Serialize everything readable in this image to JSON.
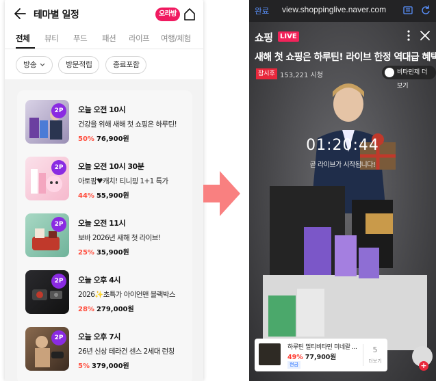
{
  "left": {
    "header": {
      "title": "테마별 일정",
      "live_badge": "오라방"
    },
    "tabs": [
      "전체",
      "뷰티",
      "푸드",
      "패션",
      "라이프",
      "여행/체험"
    ],
    "filters": [
      "방송",
      "방문적립",
      "종료포함"
    ],
    "items": [
      {
        "time": "오늘 오전 10시",
        "title": "건강을 위해 새해 첫 쇼핑은 하루틴!",
        "discount": "50%",
        "price": "76,900원",
        "badge": "2P"
      },
      {
        "time": "오늘 오전 10시 30분",
        "title": "아토팜♥캐치! 티니핑 1+1 특가",
        "discount": "44%",
        "price": "55,900원",
        "badge": "2P"
      },
      {
        "time": "오늘 오전 11시",
        "title": "보바 2026년 새해 첫 라이브!",
        "discount": "25%",
        "price": "35,900원",
        "badge": "2P"
      },
      {
        "time": "오늘 오후 4시",
        "title": "2026✨초특가 아이언맨 블랙박스",
        "discount": "28%",
        "price": "279,000원",
        "badge": "2P"
      },
      {
        "time": "오늘 오후 7시",
        "title": "26년 신상 테라건 센스 2세대 런칭",
        "discount": "5%",
        "price": "379,000원",
        "badge": "2P"
      }
    ]
  },
  "right": {
    "urlbar": {
      "done": "완료",
      "url": "view.shoppinglive.naver.com"
    },
    "brand": "쇼핑",
    "live_tag": "LIVE",
    "title": "새해 첫 쇼핑은 하루틴! 라이브 한정 역대급 혜택",
    "view_tag": "잠시후",
    "view_count": "153,221 시청",
    "more_pill": "비타민제 더보기",
    "countdown": "01:20:44",
    "starting": "곧 라이브가 시작됩니다!",
    "product": {
      "name": "하루틴 멀티비타민 미네랄 ...",
      "discount": "49%",
      "price": "77,900원",
      "badge": "현금",
      "count": "5",
      "more": "더보기"
    }
  },
  "colors": {
    "accent": "#f01a60",
    "discount": "#ff4d3d",
    "badge_purple": "#8a2be2",
    "arrow": "#f98080"
  }
}
